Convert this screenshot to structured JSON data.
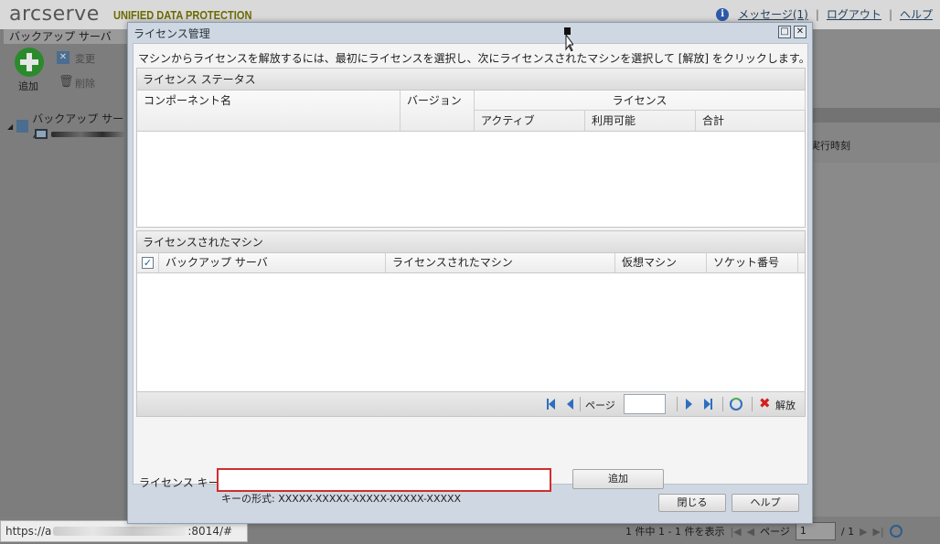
{
  "app": {
    "logo": "arcserve",
    "logo_sub": "UNIFIED DATA PROTECTION",
    "messages_link": "メッセージ(1)",
    "logout_link": "ログアウト",
    "help_link": "ヘルプ",
    "separator": "|"
  },
  "left_panel": {
    "title": "バックアップ サーバ",
    "add_label": "追加",
    "edit_label": "変更",
    "delete_label": "削除",
    "tree_root": "バックアップ サーバ"
  },
  "right_panel": {
    "column_exec_time": "実行時刻"
  },
  "bottom": {
    "status": "1 件中 1 - 1 件を表示",
    "page_label": "ページ",
    "page_value": "1",
    "page_total": "/ 1"
  },
  "browser": {
    "url_prefix": "https://a",
    "url_suffix": ":8014/#"
  },
  "dialog": {
    "title": "ライセンス管理",
    "instruction": "マシンからライセンスを解放するには、最初にライセンスを選択し、次にライセンスされたマシンを選択して [解放] をクリックします。",
    "license_status": {
      "header": "ライセンス ステータス",
      "col_component": "コンポーネント名",
      "col_version": "バージョン",
      "col_license": "ライセンス",
      "col_active": "アクティブ",
      "col_available": "利用可能",
      "col_total": "合計"
    },
    "licensed_machines": {
      "header": "ライセンスされたマシン",
      "col_backup_server": "バックアップ サーバ",
      "col_licensed_machine": "ライセンスされたマシン",
      "col_virtual_machine": "仮想マシン",
      "col_socket": "ソケット番号",
      "select_all_checked": true
    },
    "pager": {
      "page_label": "ページ",
      "page_value": "",
      "release_label": "解放"
    },
    "license_key": {
      "label": "ライセンス キー",
      "value": "",
      "add_button": "追加",
      "format_hint": "キーの形式: XXXXX-XXXXX-XXXXX-XXXXX-XXXXX"
    },
    "close_button": "閉じる",
    "help_button": "ヘルプ"
  }
}
